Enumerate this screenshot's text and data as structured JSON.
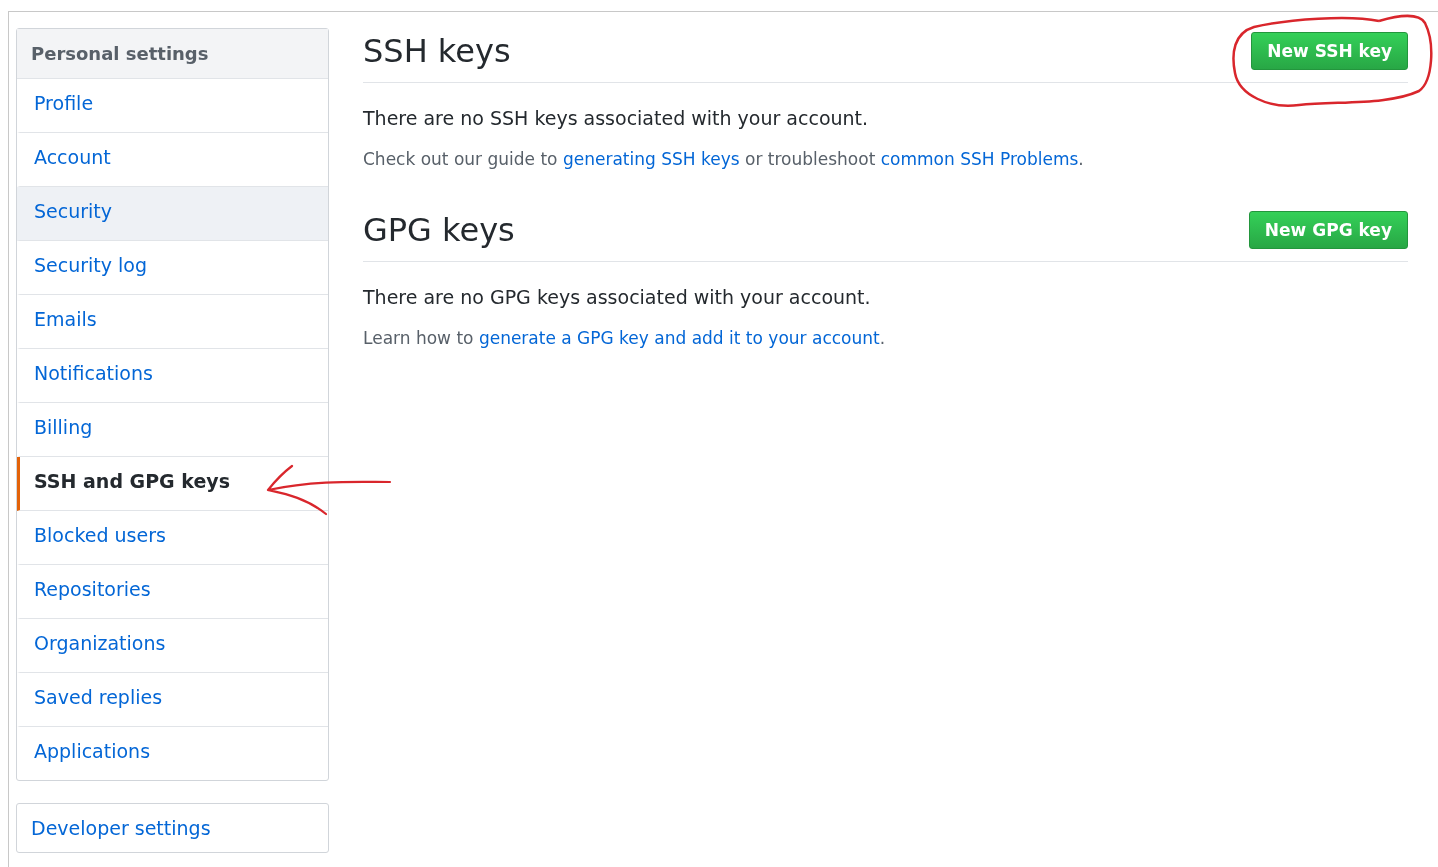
{
  "sidebar": {
    "heading": "Personal settings",
    "items": [
      {
        "label": "Profile",
        "selected": false,
        "hovered": false
      },
      {
        "label": "Account",
        "selected": false,
        "hovered": false
      },
      {
        "label": "Security",
        "selected": false,
        "hovered": true
      },
      {
        "label": "Security log",
        "selected": false,
        "hovered": false
      },
      {
        "label": "Emails",
        "selected": false,
        "hovered": false
      },
      {
        "label": "Notifications",
        "selected": false,
        "hovered": false
      },
      {
        "label": "Billing",
        "selected": false,
        "hovered": false
      },
      {
        "label": "SSH and GPG keys",
        "selected": true,
        "hovered": false
      },
      {
        "label": "Blocked users",
        "selected": false,
        "hovered": false
      },
      {
        "label": "Repositories",
        "selected": false,
        "hovered": false
      },
      {
        "label": "Organizations",
        "selected": false,
        "hovered": false
      },
      {
        "label": "Saved replies",
        "selected": false,
        "hovered": false
      },
      {
        "label": "Applications",
        "selected": false,
        "hovered": false
      }
    ],
    "developer": {
      "label": "Developer settings"
    }
  },
  "sections": [
    {
      "title": "SSH keys",
      "button": "New SSH key",
      "empty": "There are no SSH keys associated with your account.",
      "help": [
        {
          "kind": "text",
          "text": "Check out our guide to "
        },
        {
          "kind": "link",
          "text": "generating SSH keys"
        },
        {
          "kind": "text",
          "text": " or troubleshoot "
        },
        {
          "kind": "link",
          "text": "common SSH Problems"
        },
        {
          "kind": "text",
          "text": "."
        }
      ]
    },
    {
      "title": "GPG keys",
      "button": "New GPG key",
      "empty": "There are no GPG keys associated with your account.",
      "help": [
        {
          "kind": "text",
          "text": "Learn how to "
        },
        {
          "kind": "link",
          "text": "generate a GPG key and add it to your account"
        },
        {
          "kind": "text",
          "text": "."
        }
      ]
    }
  ]
}
